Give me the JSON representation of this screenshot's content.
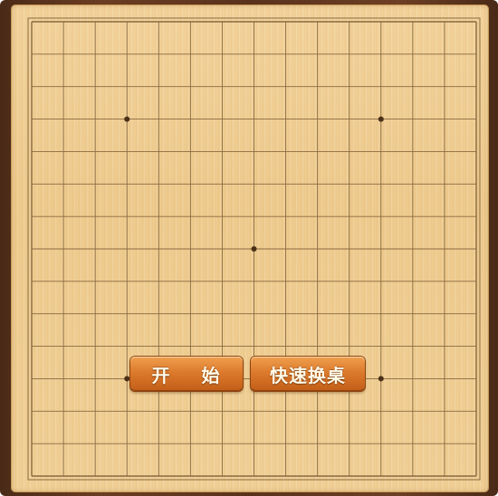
{
  "game": {
    "type": "go-board",
    "board_size": 15,
    "star_points": [
      [
        3,
        3
      ],
      [
        11,
        3
      ],
      [
        7,
        7
      ],
      [
        3,
        11
      ],
      [
        11,
        11
      ]
    ],
    "stones": []
  },
  "buttons": {
    "start_label": "开 始",
    "switch_table_label": "快速换桌"
  },
  "colors": {
    "frame": "#5a321c",
    "board": "#f1d096",
    "grid_line": "#8a6a40",
    "button_top": "#f0a050",
    "button_bottom": "#c25e18",
    "button_text": "#fffbe9"
  }
}
